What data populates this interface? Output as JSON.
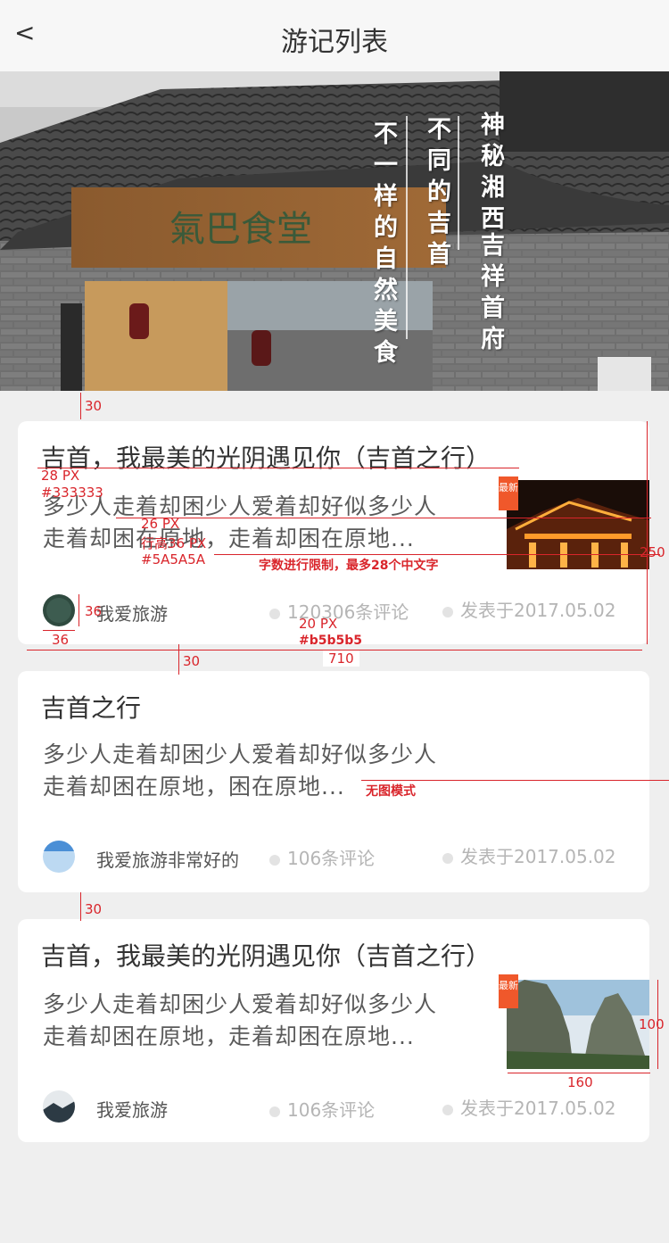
{
  "header": {
    "back_label": "<",
    "title": "游记列表"
  },
  "banner": {
    "sign": "氣巴食堂",
    "col1": "神秘湘西",
    "col1b": "吉祥首府",
    "col2": "不同的吉首",
    "col3": "不一样的自然美食"
  },
  "cards": [
    {
      "title": "吉首，我最美的光阴遇见你（吉首之行）",
      "line1": "多少人走着却困少人爱着却好似多少人",
      "line2": "走着却困在原地，走着却困在原地...",
      "badge": "最新",
      "author": "我爱旅游",
      "comments": "120306条评论",
      "date": "发表于2017.05.02"
    },
    {
      "title": "吉首之行",
      "line1": "多少人走着却困少人爱着却好似多少人",
      "line2": "走着却困在原地，困在原地...",
      "author": "我爱旅游非常好的",
      "comments": "106条评论",
      "date": "发表于2017.05.02"
    },
    {
      "title": "吉首，我最美的光阴遇见你（吉首之行）",
      "line1": "多少人走着却困少人爱着却好似多少人",
      "line2": "走着却困在原地，走着却困在原地...",
      "badge": "最新",
      "author": "我爱旅游",
      "comments": "106条评论",
      "date": "发表于2017.05.02"
    }
  ],
  "annotations": {
    "gap1": "30",
    "title_size": "28 PX",
    "title_color": "#333333",
    "body_size": "26 PX",
    "body_lh": "行高36 PX",
    "body_color": "#5A5A5A",
    "limit": "字数进行限制，最多28个中文字",
    "card_h": "250",
    "avatar_h": "36",
    "avatar_w": "36",
    "meta_size": "20 PX",
    "meta_color": "#b5b5b5",
    "card_w": "710",
    "gap2": "30",
    "no_image": "无图模式",
    "gap3": "30",
    "img_h": "100",
    "img_w": "160"
  }
}
